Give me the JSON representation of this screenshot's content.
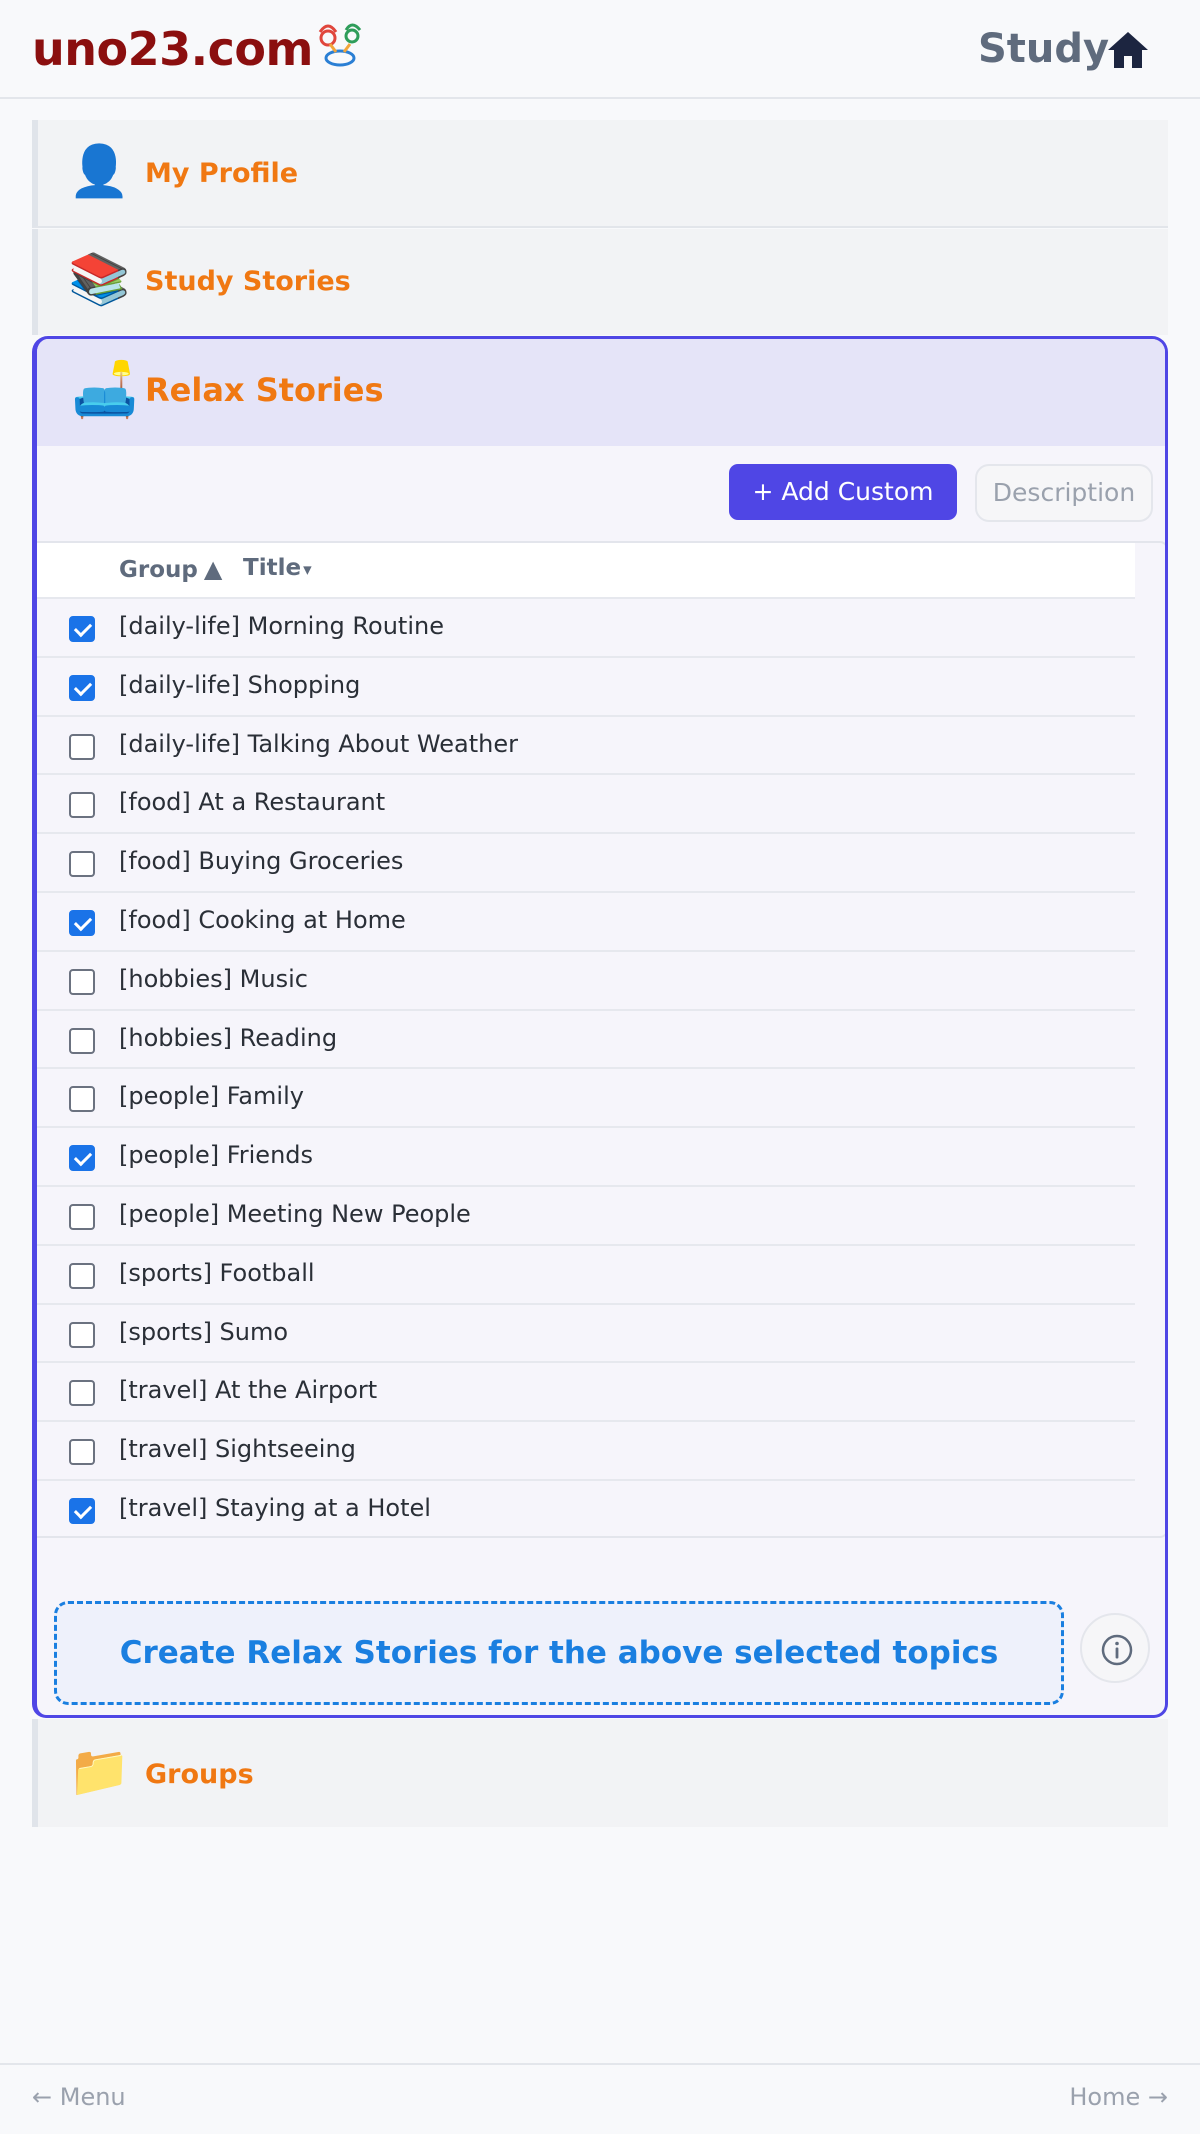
{
  "header": {
    "brand": "uno23.com",
    "study_label": "Study"
  },
  "sections": {
    "profile": {
      "label": "My Profile",
      "icon": "person-icon"
    },
    "study": {
      "label": "Study Stories",
      "icon": "books-icon"
    },
    "relax": {
      "label": "Relax Stories",
      "icon": "couch-lamp-icon"
    },
    "groups": {
      "label": "Groups",
      "icon": "folder-icon"
    }
  },
  "toolbar": {
    "add_custom_label": "+ Add Custom",
    "description_label": "Description"
  },
  "table": {
    "columns": [
      {
        "label": "Group",
        "sort": "▲"
      },
      {
        "label": "Title",
        "sort": "▾"
      }
    ],
    "rows": [
      {
        "label": "[daily-life] Morning Routine",
        "checked": true
      },
      {
        "label": "[daily-life] Shopping",
        "checked": true
      },
      {
        "label": "[daily-life] Talking About Weather",
        "checked": false
      },
      {
        "label": "[food] At a Restaurant",
        "checked": false
      },
      {
        "label": "[food] Buying Groceries",
        "checked": false
      },
      {
        "label": "[food] Cooking at Home",
        "checked": true
      },
      {
        "label": "[hobbies] Music",
        "checked": false
      },
      {
        "label": "[hobbies] Reading",
        "checked": false
      },
      {
        "label": "[people] Family",
        "checked": false
      },
      {
        "label": "[people] Friends",
        "checked": true
      },
      {
        "label": "[people] Meeting New People",
        "checked": false
      },
      {
        "label": "[sports] Football",
        "checked": false
      },
      {
        "label": "[sports] Sumo",
        "checked": false
      },
      {
        "label": "[travel] At the Airport",
        "checked": false
      },
      {
        "label": "[travel] Sightseeing",
        "checked": false
      },
      {
        "label": "[travel] Staying at a Hotel",
        "checked": true
      }
    ]
  },
  "create_button": "Create Relax Stories for the above selected topics",
  "footer": {
    "menu": "← Menu",
    "home": "Home →"
  },
  "colors": {
    "brand": "#8b0f0f",
    "section_label": "#f07812",
    "accent": "#4f46e5",
    "checkbox": "#1a73e8",
    "create": "#1a7fe0"
  }
}
